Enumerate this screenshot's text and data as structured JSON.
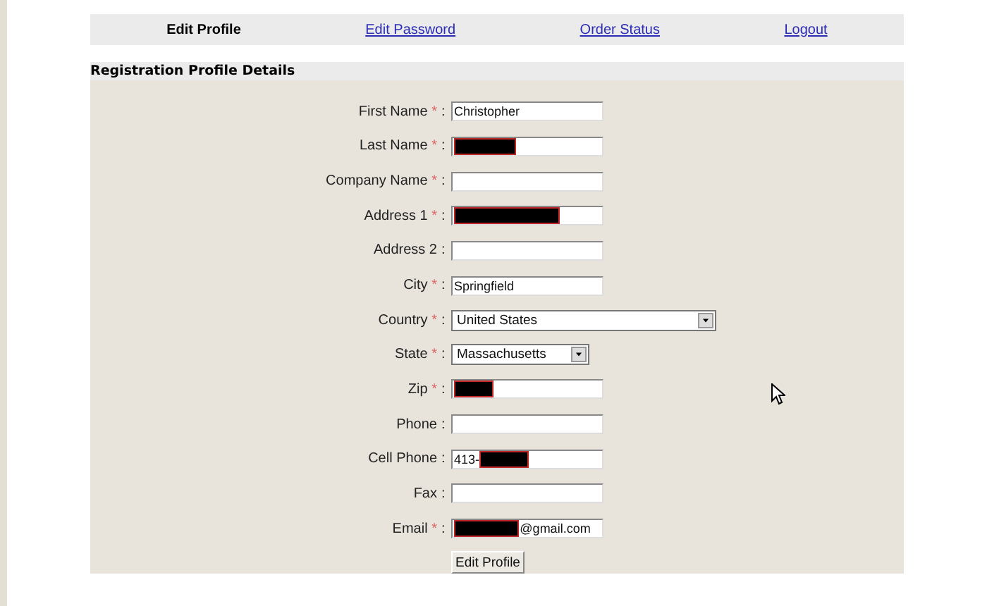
{
  "nav": [
    {
      "label": "Edit Profile",
      "selected": true
    },
    {
      "label": "Edit Password",
      "selected": false
    },
    {
      "label": "Order Status",
      "selected": false
    },
    {
      "label": "Logout",
      "selected": false
    }
  ],
  "section": {
    "title": "Registration Profile Details"
  },
  "fields": [
    {
      "kind": "text",
      "label": "First Name",
      "required": true,
      "value": "Christopher",
      "redacted": false
    },
    {
      "kind": "text",
      "label": "Last Name",
      "required": true,
      "redacted": true,
      "level": 0.4
    },
    {
      "kind": "text",
      "label": "Company Name",
      "required": true,
      "redacted": false
    },
    {
      "kind": "text",
      "label": "Address 1",
      "required": true,
      "redacted": true,
      "level": 0.7
    },
    {
      "kind": "text",
      "label": "Address 2",
      "required": false,
      "redacted": false
    },
    {
      "kind": "text",
      "label": "City",
      "required": true,
      "value": "Springfield",
      "redacted": false
    },
    {
      "kind": "select",
      "label": "Country",
      "required": true,
      "value": "United States",
      "wide": true
    },
    {
      "kind": "select",
      "label": "State",
      "required": true,
      "value": "Massachusetts",
      "wide": false
    },
    {
      "kind": "text",
      "label": "Zip",
      "required": true,
      "redacted": true,
      "level": 0.25
    },
    {
      "kind": "text",
      "label": "Phone",
      "required": false,
      "redacted": false
    },
    {
      "kind": "text",
      "label": "Cell Phone",
      "required": false,
      "value": "413-",
      "redacted": true,
      "redaction_first": false,
      "level": 0.32
    },
    {
      "kind": "text",
      "label": "Fax",
      "required": false,
      "redacted": false
    },
    {
      "kind": "text",
      "label": "Email",
      "required": true,
      "value": "@gmail.com",
      "redacted": true,
      "redaction_first": true,
      "level": 0.42
    }
  ],
  "separator": ":",
  "required_mark": "*",
  "submit": {
    "label": "Edit Profile"
  }
}
